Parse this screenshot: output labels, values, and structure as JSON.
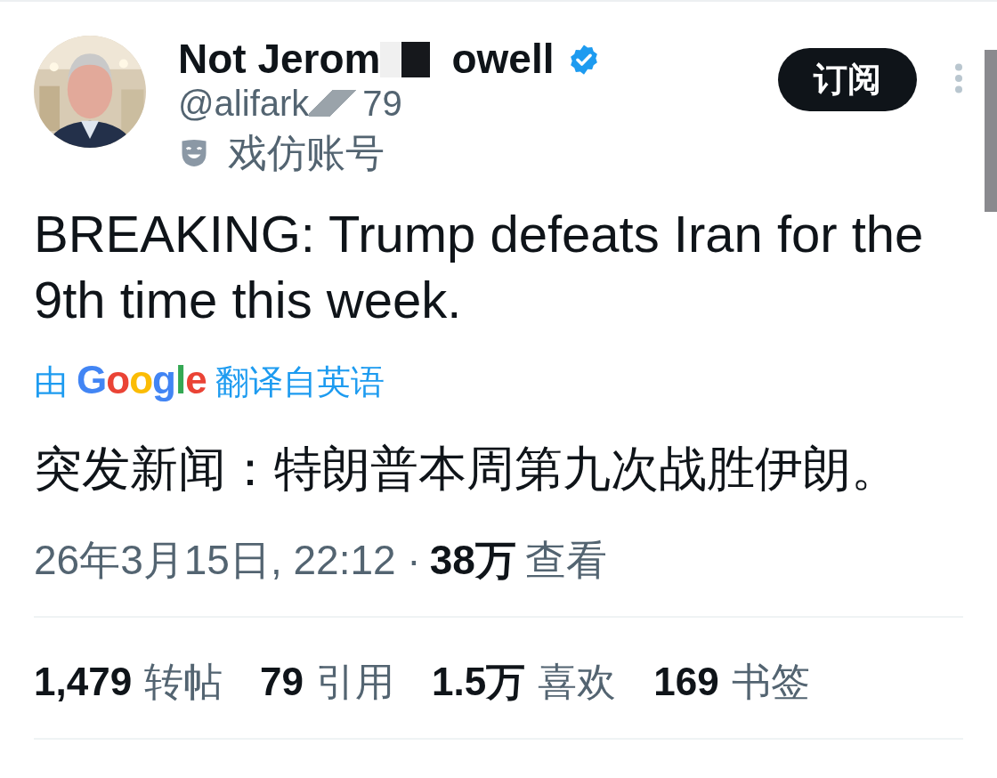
{
  "author": {
    "name_parts": [
      "Not Jerom",
      "owell"
    ],
    "verified": true,
    "handle_parts": [
      "@alifark",
      "79"
    ],
    "label": "戏仿账号"
  },
  "subscribe_button": "订阅",
  "tweet_text": "BREAKING: Trump defeats Iran for the 9th time this week.",
  "translation": {
    "prefix": "由",
    "service": "Google",
    "suffix": "翻译自英语",
    "text": "突发新闻：特朗普本周第九次战胜伊朗。"
  },
  "meta": {
    "timestamp": "26年3月15日, 22:12 ·",
    "views_count": "38万",
    "views_label": "查看"
  },
  "stats": [
    {
      "count": "1,479",
      "label": "转帖"
    },
    {
      "count": "79",
      "label": "引用"
    },
    {
      "count": "1.5万",
      "label": "喜欢"
    },
    {
      "count": "169",
      "label": "书签"
    }
  ]
}
